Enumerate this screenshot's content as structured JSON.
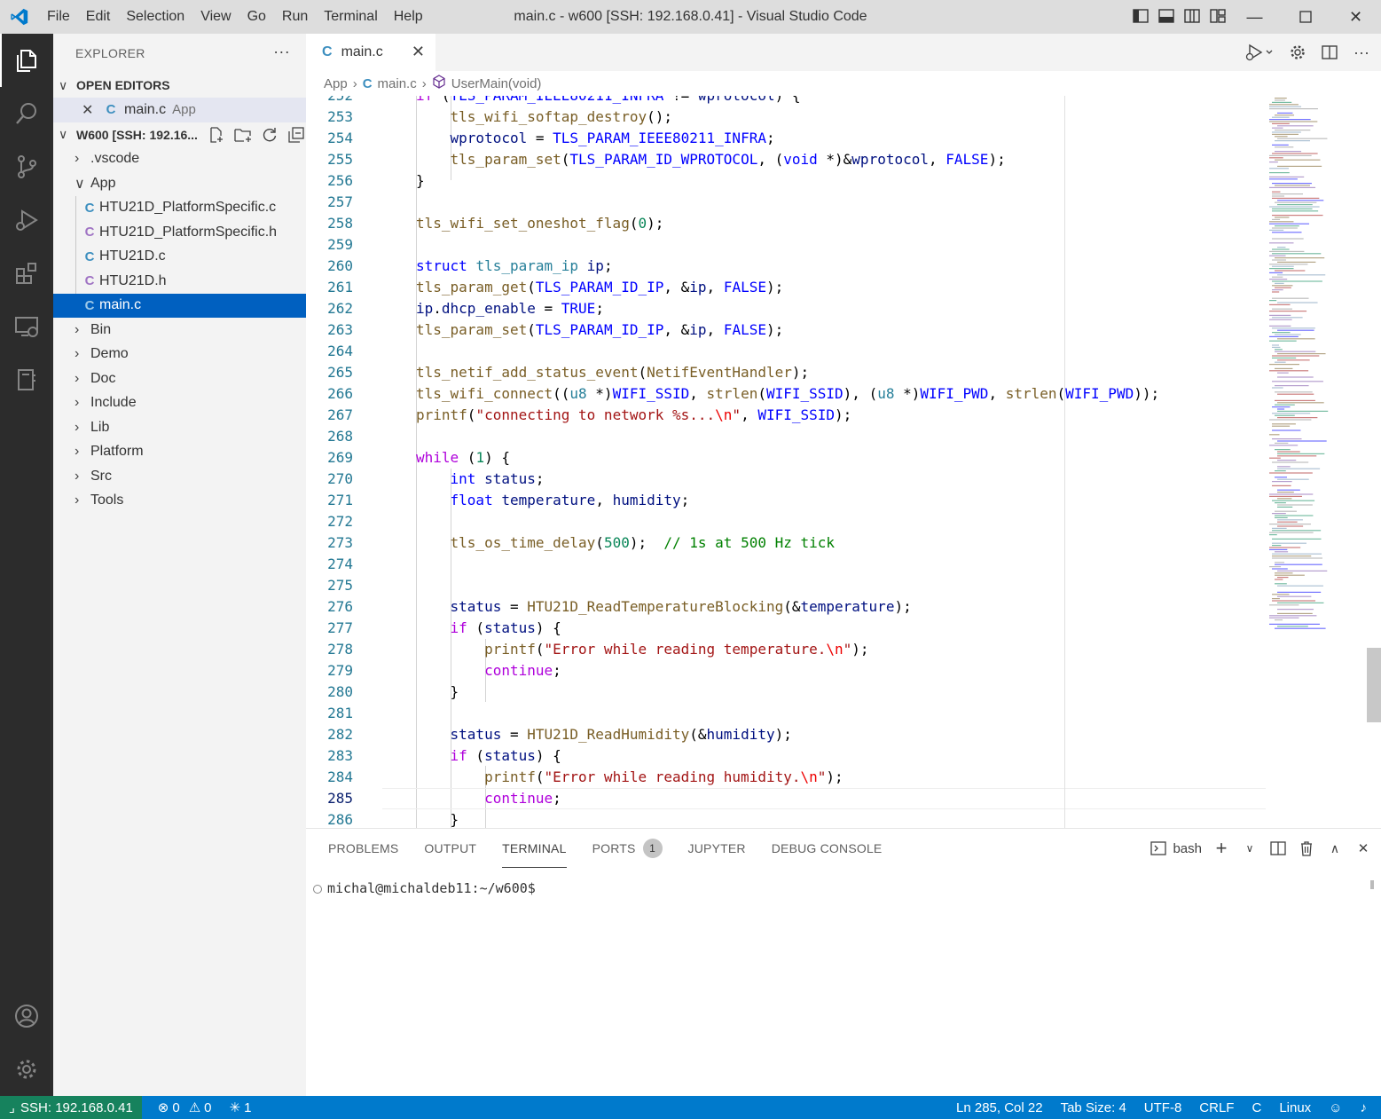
{
  "window": {
    "title": "main.c - w600 [SSH: 192.168.0.41] - Visual Studio Code",
    "menu": [
      "File",
      "Edit",
      "Selection",
      "View",
      "Go",
      "Run",
      "Terminal",
      "Help"
    ]
  },
  "sidebar": {
    "header": "EXPLORER",
    "open_editors_title": "OPEN EDITORS",
    "open_editor": {
      "name": "main.c",
      "folder": "App"
    },
    "workspace_title": "W600 [SSH: 192.16...",
    "tree": [
      {
        "label": ".vscode",
        "kind": "folder",
        "expanded": false
      },
      {
        "label": "App",
        "kind": "folder",
        "expanded": true
      },
      {
        "label": "HTU21D_PlatformSpecific.c",
        "kind": "c"
      },
      {
        "label": "HTU21D_PlatformSpecific.h",
        "kind": "h"
      },
      {
        "label": "HTU21D.c",
        "kind": "c"
      },
      {
        "label": "HTU21D.h",
        "kind": "h"
      },
      {
        "label": "main.c",
        "kind": "c",
        "selected": true
      },
      {
        "label": "Bin",
        "kind": "folder"
      },
      {
        "label": "Demo",
        "kind": "folder"
      },
      {
        "label": "Doc",
        "kind": "folder"
      },
      {
        "label": "Include",
        "kind": "folder"
      },
      {
        "label": "Lib",
        "kind": "folder"
      },
      {
        "label": "Platform",
        "kind": "folder"
      },
      {
        "label": "Src",
        "kind": "folder"
      },
      {
        "label": "Tools",
        "kind": "folder"
      }
    ]
  },
  "editor": {
    "tab_label": "main.c",
    "tab_icon": "C",
    "breadcrumb": [
      "App",
      "main.c",
      "UserMain(void)"
    ],
    "current_line": 285
  },
  "panel": {
    "tabs": [
      "PROBLEMS",
      "OUTPUT",
      "TERMINAL",
      "PORTS",
      "JUPYTER",
      "DEBUG CONSOLE"
    ],
    "active_tab": "TERMINAL",
    "ports_badge": "1",
    "shell": "bash",
    "prompt": "michal@michaldeb11:~/w600$"
  },
  "statusbar": {
    "remote": "SSH: 192.168.0.41",
    "errors": "0",
    "warnings": "0",
    "ports": "1",
    "position": "Ln 285, Col 22",
    "tab_size": "Tab Size: 4",
    "encoding": "UTF-8",
    "eol": "CRLF",
    "language": "C",
    "os": "Linux"
  },
  "colors": {
    "activity_bar": "#2c2c2c",
    "status_bar": "#007acc",
    "remote": "#16825d",
    "selection": "#0060c0"
  }
}
